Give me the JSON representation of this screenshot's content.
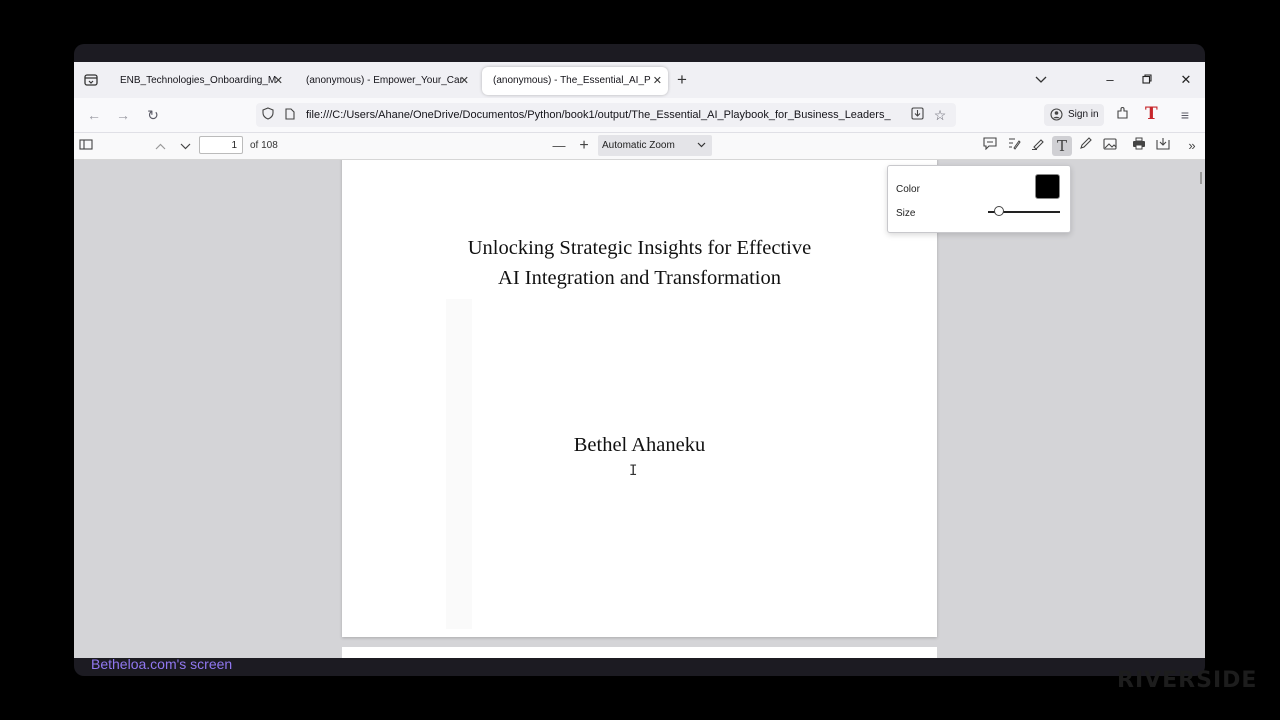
{
  "tabs": [
    {
      "title": "ENB_Technologies_Onboarding_Ma",
      "active": false
    },
    {
      "title": "(anonymous) - Empower_Your_Care",
      "active": false
    },
    {
      "title": "(anonymous) - The_Essential_AI_Pla",
      "active": true
    }
  ],
  "navbar": {
    "url": "file:///C:/Users/Ahane/OneDrive/Documentos/Python/book1/output/The_Essential_AI_Playbook_for_Business_Leaders_",
    "signin_label": "Sign in"
  },
  "pdf_toolbar": {
    "page_number": "1",
    "page_count_label": "of 108",
    "zoom_label": "Automatic Zoom"
  },
  "text_editor_popup": {
    "color_label": "Color",
    "color_value": "#000000",
    "size_label": "Size",
    "size_level": 0.1
  },
  "document": {
    "title_line1": "Unlocking Strategic Insights for Effective",
    "title_line2": "AI Integration and Transformation",
    "author": "Bethel Ahaneku"
  },
  "overlay": {
    "screen_label": "Betheloa.com's screen",
    "brand": "RIVERSIDE"
  },
  "colors": {
    "accent_red": "#c7262b",
    "screen_label": "#9178f0"
  },
  "icons": [
    "tab-list-icon",
    "close-icon",
    "new-tab-icon",
    "chevron-down-icon",
    "minimize-icon",
    "restore-icon",
    "back-icon",
    "forward-icon",
    "reload-icon",
    "shield-icon",
    "page-icon",
    "download-icon",
    "bookmark-star-icon",
    "account-icon",
    "extensions-icon",
    "menu-icon",
    "sidebar-toggle-icon",
    "comment-icon",
    "signature-icon",
    "highlight-icon",
    "text-icon",
    "draw-icon",
    "image-icon",
    "print-icon",
    "save-icon",
    "more-tools-icon"
  ]
}
